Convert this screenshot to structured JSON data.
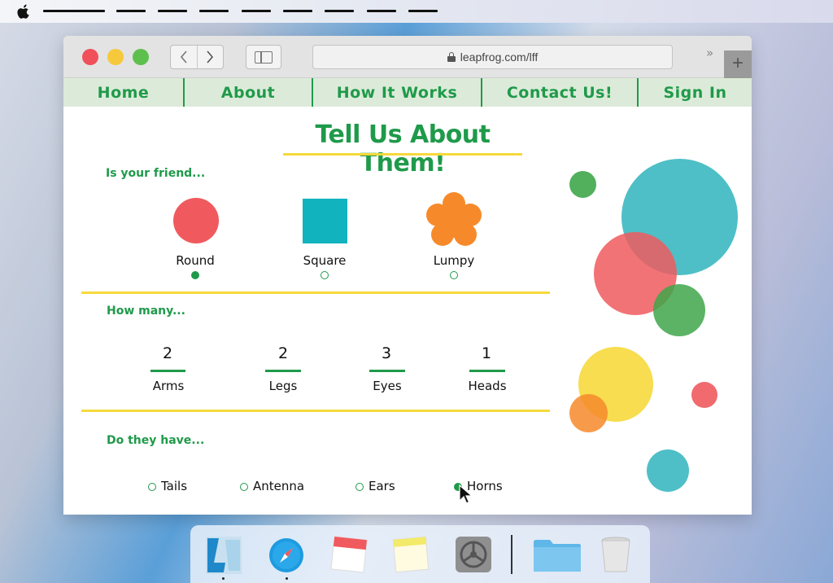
{
  "menubar": {
    "apple_icon": "apple-logo-icon",
    "menu_items_count_note": ""
  },
  "browser": {
    "url": "leapfrog.com/lff",
    "back_icon": "chevron-left-icon",
    "forward_icon": "chevron-right-icon",
    "sidebar_icon": "sidebar-icon",
    "lock_icon": "lock-icon",
    "more_label": "»",
    "newtab_label": "+"
  },
  "site_nav": {
    "items": [
      {
        "label": "Home"
      },
      {
        "label": "About"
      },
      {
        "label": "How It Works"
      },
      {
        "label": "Contact Us!"
      },
      {
        "label": "Sign In"
      }
    ]
  },
  "page": {
    "title": "Tell Us About Them!",
    "shape_section": {
      "label": "Is your friend...",
      "options": [
        {
          "label": "Round",
          "selected": true,
          "color": "#f05a5e"
        },
        {
          "label": "Square",
          "selected": false,
          "color": "#11b3bf"
        },
        {
          "label": "Lumpy",
          "selected": false,
          "color": "#f68a2a"
        }
      ]
    },
    "count_section": {
      "label": "How many...",
      "counts": [
        {
          "value": "2",
          "label": "Arms"
        },
        {
          "value": "2",
          "label": "Legs"
        },
        {
          "value": "3",
          "label": "Eyes"
        },
        {
          "value": "1",
          "label": "Heads"
        }
      ]
    },
    "features_section": {
      "label": "Do they have...",
      "options": [
        {
          "label": "Tails",
          "selected": false
        },
        {
          "label": "Antenna",
          "selected": false
        },
        {
          "label": "Ears",
          "selected": false
        },
        {
          "label": "Horns",
          "selected": true
        }
      ]
    }
  },
  "colors": {
    "accent_green": "#1f9a4a",
    "accent_yellow": "#f6d93c",
    "nav_bg": "#dcebd9"
  },
  "dock": {
    "items": [
      {
        "icon": "leapfrog-app-icon"
      },
      {
        "icon": "safari-compass-icon"
      },
      {
        "icon": "calendar-icon"
      },
      {
        "icon": "notes-icon"
      },
      {
        "icon": "system-preferences-icon"
      },
      {
        "icon": "folder-icon"
      },
      {
        "icon": "trash-icon"
      }
    ]
  }
}
